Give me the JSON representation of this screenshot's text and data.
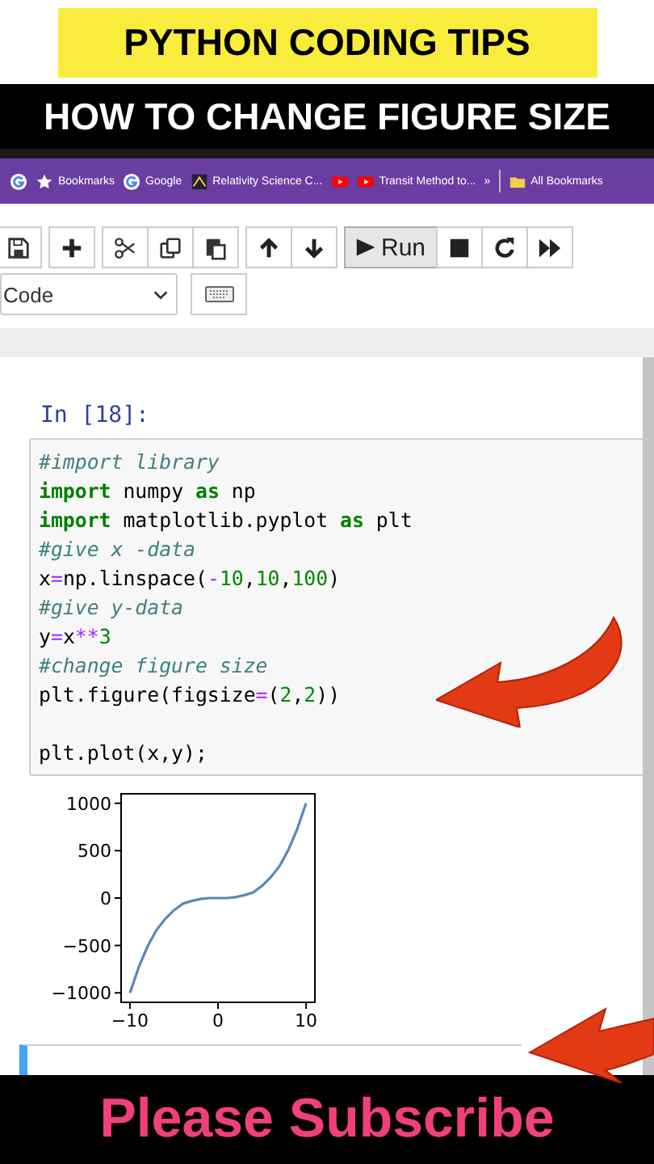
{
  "video_overlay": {
    "title": "PYTHON CODING TIPS",
    "subtitle": "HOW TO CHANGE FIGURE SIZE",
    "footer": "Please Subscribe"
  },
  "bookmarks_bar": {
    "items": [
      {
        "kind": "google"
      },
      {
        "kind": "star",
        "label": "Bookmarks"
      },
      {
        "kind": "google",
        "label": "Google"
      },
      {
        "kind": "image",
        "label": "Relativity Science C..."
      },
      {
        "kind": "youtube"
      },
      {
        "kind": "youtube",
        "label": "Transit Method to..."
      },
      {
        "kind": "more",
        "label": "»"
      },
      {
        "kind": "folder",
        "label": "All Bookmarks"
      }
    ]
  },
  "toolbar": {
    "groups": [
      [
        {
          "kind": "save"
        }
      ],
      [
        {
          "kind": "add"
        }
      ],
      [
        {
          "kind": "cut"
        },
        {
          "kind": "copy"
        },
        {
          "kind": "paste"
        }
      ],
      [
        {
          "kind": "up"
        },
        {
          "kind": "down"
        }
      ],
      [
        {
          "kind": "run",
          "label": "Run"
        },
        {
          "kind": "stop"
        },
        {
          "kind": "restart"
        },
        {
          "kind": "fast-forward"
        }
      ]
    ],
    "cell_type": "Code"
  },
  "cells": [
    {
      "prompt": "In [18]:",
      "lines": [
        [
          {
            "kind": "comment",
            "s": "#import library"
          }
        ],
        [
          {
            "kind": "keyword",
            "s": "import"
          },
          {
            "kind": "plain",
            "s": " numpy "
          },
          {
            "kind": "keyword",
            "s": "as"
          },
          {
            "kind": "plain",
            "s": " np"
          }
        ],
        [
          {
            "kind": "keyword",
            "s": "import"
          },
          {
            "kind": "plain",
            "s": " matplotlib.pyplot "
          },
          {
            "kind": "keyword",
            "s": "as"
          },
          {
            "kind": "plain",
            "s": " plt"
          }
        ],
        [
          {
            "kind": "comment",
            "s": "#give x -data"
          }
        ],
        [
          {
            "kind": "plain",
            "s": "x"
          },
          {
            "kind": "operator",
            "s": "="
          },
          {
            "kind": "plain",
            "s": "np.linspace("
          },
          {
            "kind": "operator",
            "s": "-"
          },
          {
            "kind": "number",
            "s": "10"
          },
          {
            "kind": "plain",
            "s": ","
          },
          {
            "kind": "number",
            "s": "10"
          },
          {
            "kind": "plain",
            "s": ","
          },
          {
            "kind": "number",
            "s": "100"
          },
          {
            "kind": "plain",
            "s": ")"
          }
        ],
        [
          {
            "kind": "comment",
            "s": "#give y-data"
          }
        ],
        [
          {
            "kind": "plain",
            "s": "y"
          },
          {
            "kind": "operator",
            "s": "="
          },
          {
            "kind": "plain",
            "s": "x"
          },
          {
            "kind": "operator",
            "s": "**"
          },
          {
            "kind": "number",
            "s": "3"
          }
        ],
        [
          {
            "kind": "comment",
            "s": "#change figure size"
          }
        ],
        [
          {
            "kind": "plain",
            "s": "plt.figure(figsize"
          },
          {
            "kind": "operator",
            "s": "="
          },
          {
            "kind": "plain",
            "s": "("
          },
          {
            "kind": "number",
            "s": "2"
          },
          {
            "kind": "plain",
            "s": ","
          },
          {
            "kind": "number",
            "s": "2"
          },
          {
            "kind": "plain",
            "s": "))"
          }
        ],
        [
          {
            "kind": "blank"
          }
        ],
        [
          {
            "kind": "plain",
            "s": "plt.plot(x,y);"
          }
        ]
      ],
      "output": {
        "chart_data": {
          "type": "line",
          "x": [
            -10,
            -9,
            -8,
            -7,
            -6,
            -5,
            -4,
            -3,
            -2,
            -1,
            0,
            1,
            2,
            3,
            4,
            5,
            6,
            7,
            8,
            9,
            10
          ],
          "series": [
            {
              "color": "#5b87b8",
              "values": [
                -1000,
                -730,
                -510,
                -340,
                -220,
                -130,
                -60,
                -30,
                -10,
                0,
                0,
                0,
                10,
                30,
                60,
                130,
                220,
                340,
                510,
                730,
                1000
              ]
            }
          ],
          "xlim": [
            -11,
            11
          ],
          "ylim": [
            -1100,
            1100
          ],
          "xticks": [
            {
              "value": -10,
              "label": "−10"
            },
            {
              "value": 0,
              "label": "0"
            },
            {
              "value": 10,
              "label": "10"
            }
          ],
          "yticks": [
            {
              "value": -1000,
              "label": "−1000"
            },
            {
              "value": -500,
              "label": "−500"
            },
            {
              "value": 0,
              "label": "0"
            },
            {
              "value": 500,
              "label": "500"
            },
            {
              "value": 1000,
              "label": "1000"
            }
          ]
        }
      }
    },
    {
      "selected": true
    }
  ]
}
